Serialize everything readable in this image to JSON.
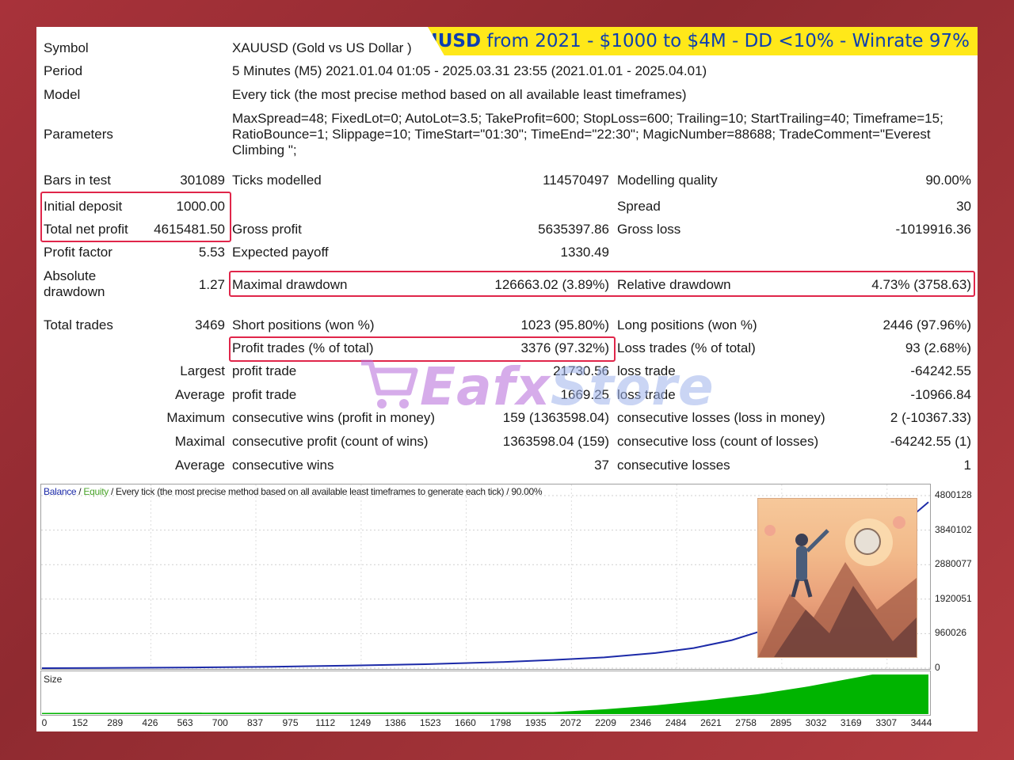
{
  "banner": {
    "symbol": "XAUUSD",
    "rest": " from 2021 - $1000 to $4M - DD <10% - Winrate 97%"
  },
  "header": {
    "symbol_label": "Symbol",
    "symbol_value": "XAUUSD (Gold vs US Dollar )",
    "period_label": "Period",
    "period_value": "5 Minutes (M5) 2021.01.04 01:05 - 2025.03.31 23:55 (2021.01.01 - 2025.04.01)",
    "model_label": "Model",
    "model_value": "Every tick (the most precise method based on all available least timeframes)",
    "params_label": "Parameters",
    "params_value": "MaxSpread=48; FixedLot=0; AutoLot=3.5; TakeProfit=600; StopLoss=600; Trailing=10; StartTrailing=40; Timeframe=15; RatioBounce=1; Slippage=10; TimeStart=\"01:30\"; TimeEnd=\"22:30\"; MagicNumber=88688; TradeComment=\"Everest Climbing \";"
  },
  "stats": {
    "bars_label": "Bars in test",
    "bars_value": "301089",
    "ticks_label": "Ticks modelled",
    "ticks_value": "114570497",
    "quality_label": "Modelling quality",
    "quality_value": "90.00%",
    "deposit_label": "Initial deposit",
    "deposit_value": "1000.00",
    "spread_label": "Spread",
    "spread_value": "30",
    "netprofit_label": "Total net profit",
    "netprofit_value": "4615481.50",
    "grossprofit_label": "Gross profit",
    "grossprofit_value": "5635397.86",
    "grossloss_label": "Gross loss",
    "grossloss_value": "-1019916.36",
    "pf_label": "Profit factor",
    "pf_value": "5.53",
    "ep_label": "Expected payoff",
    "ep_value": "1330.49",
    "absdd_label": "Absolute drawdown",
    "absdd_value": "1.27",
    "maxdd_label": "Maximal drawdown",
    "maxdd_value": "126663.02 (3.89%)",
    "reldd_label": "Relative drawdown",
    "reldd_value": "4.73% (3758.63)",
    "trades_label": "Total trades",
    "trades_value": "3469",
    "short_label": "Short positions (won %)",
    "short_value": "1023 (95.80%)",
    "long_label": "Long positions (won %)",
    "long_value": "2446 (97.96%)",
    "pt_label": "Profit trades (% of total)",
    "pt_value": "3376 (97.32%)",
    "lt_label": "Loss trades (% of total)",
    "lt_value": "93 (2.68%)",
    "largest_label": "Largest",
    "largest_pt_label": "profit trade",
    "largest_pt_value": "21730.56",
    "largest_lt_label": "loss trade",
    "largest_lt_value": "-64242.55",
    "average_label": "Average",
    "average_pt_label": "profit trade",
    "average_pt_value": "1669.25",
    "average_lt_label": "loss trade",
    "average_lt_value": "-10966.84",
    "maximum_label": "Maximum",
    "max_wins_label": "consecutive wins (profit in money)",
    "max_wins_value": "159 (1363598.04)",
    "max_losses_label": "consecutive losses (loss in money)",
    "max_losses_value": "2 (-10367.33)",
    "maximal_label": "Maximal",
    "mx_profit_label": "consecutive profit (count of wins)",
    "mx_profit_value": "1363598.04 (159)",
    "mx_loss_label": "consecutive loss (count of losses)",
    "mx_loss_value": "-64242.55 (1)",
    "avg2_label": "Average",
    "avg_wins_label": "consecutive wins",
    "avg_wins_value": "37",
    "avg_losses_label": "consecutive losses",
    "avg_losses_value": "1"
  },
  "watermark": {
    "brand": "Eafx",
    "store": "Store"
  },
  "chart_legend": {
    "balance": "Balance",
    "sep1": " / ",
    "equity": "Equity",
    "rest": " / Every tick (the most precise method based on all available least timeframes to generate each tick) / 90.00%"
  },
  "size_label": "Size",
  "colors": {
    "balance": "#1c2aa8",
    "equity": "#4aa42a",
    "size_fill": "#00b400",
    "highlight": "#e0264a",
    "banner": "#ffe819"
  },
  "chart_data": {
    "type": "line",
    "title": "",
    "xlabel": "",
    "ylabel": "",
    "x_ticks": [
      0,
      152,
      289,
      426,
      563,
      700,
      837,
      975,
      1112,
      1249,
      1386,
      1523,
      1660,
      1798,
      1935,
      2072,
      2209,
      2346,
      2484,
      2621,
      2758,
      2895,
      3032,
      3169,
      3307,
      3444
    ],
    "y_ticks": [
      0,
      960026,
      1920051,
      2880077,
      3840102,
      4800128
    ],
    "ylim": [
      0,
      4800128
    ],
    "xlim": [
      0,
      3469
    ],
    "series": [
      {
        "name": "Balance",
        "color": "#1c2aa8",
        "x": [
          0,
          300,
          600,
          900,
          1200,
          1500,
          1800,
          2000,
          2200,
          2400,
          2550,
          2700,
          2800,
          2900,
          3000,
          3100,
          3200,
          3300,
          3400,
          3469
        ],
        "y": [
          1000,
          8000,
          20000,
          40000,
          70000,
          110000,
          170000,
          230000,
          300000,
          420000,
          560000,
          780000,
          1000000,
          1350000,
          1750000,
          2250000,
          2850000,
          3500000,
          4200000,
          4616481
        ]
      }
    ],
    "size": {
      "x": [
        0,
        2000,
        2200,
        2400,
        2600,
        2800,
        3000,
        3150,
        3250,
        3300,
        3469
      ],
      "y": [
        0.03,
        0.05,
        0.12,
        0.22,
        0.35,
        0.5,
        0.7,
        0.88,
        1.0,
        1.0,
        1.0
      ]
    },
    "grid": true,
    "legend_position": "top-left"
  }
}
